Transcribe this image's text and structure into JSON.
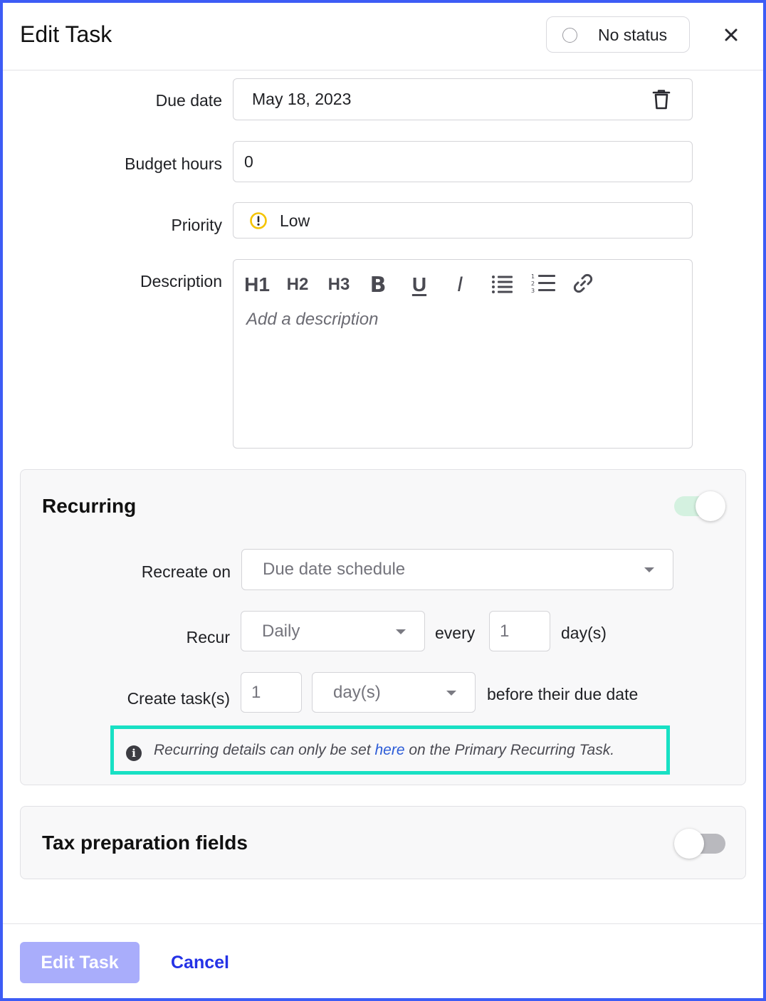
{
  "header": {
    "title": "Edit Task",
    "status_label": "No status",
    "close_glyph": "✕"
  },
  "fields": {
    "due_date": {
      "label": "Due date",
      "value": "May 18, 2023"
    },
    "budget_hours": {
      "label": "Budget hours",
      "value": "0"
    },
    "priority": {
      "label": "Priority",
      "value": "Low",
      "icon": "alert-circle-icon",
      "icon_color": "#f5c400"
    },
    "description": {
      "label": "Description",
      "placeholder": "Add a description",
      "toolbar": [
        "H1",
        "H2",
        "H3",
        "B",
        "U",
        "I"
      ]
    }
  },
  "recurring": {
    "title": "Recurring",
    "enabled": true,
    "recreate_on": {
      "label": "Recreate on",
      "value": "Due date schedule"
    },
    "recur": {
      "label": "Recur",
      "value": "Daily",
      "every_label": "every",
      "every_value": "1",
      "unit": "day(s)"
    },
    "create_tasks": {
      "label": "Create task(s)",
      "value": "1",
      "unit": "day(s)",
      "suffix": "before their due date"
    },
    "notice": {
      "before": "Recurring details can only be set ",
      "link": "here",
      "after": " on the Primary Recurring Task."
    }
  },
  "tax_prep": {
    "title": "Tax preparation fields",
    "enabled": false
  },
  "footer": {
    "primary_label": "Edit Task",
    "cancel_label": "Cancel"
  },
  "colors": {
    "accent": "#3d5cf5",
    "primary_button": "#a9adfb",
    "cancel_link": "#2432e6",
    "toggle_on": "#d4f1e0",
    "toggle_off": "#b9b9be",
    "notice_highlight": "#18e0c4"
  }
}
